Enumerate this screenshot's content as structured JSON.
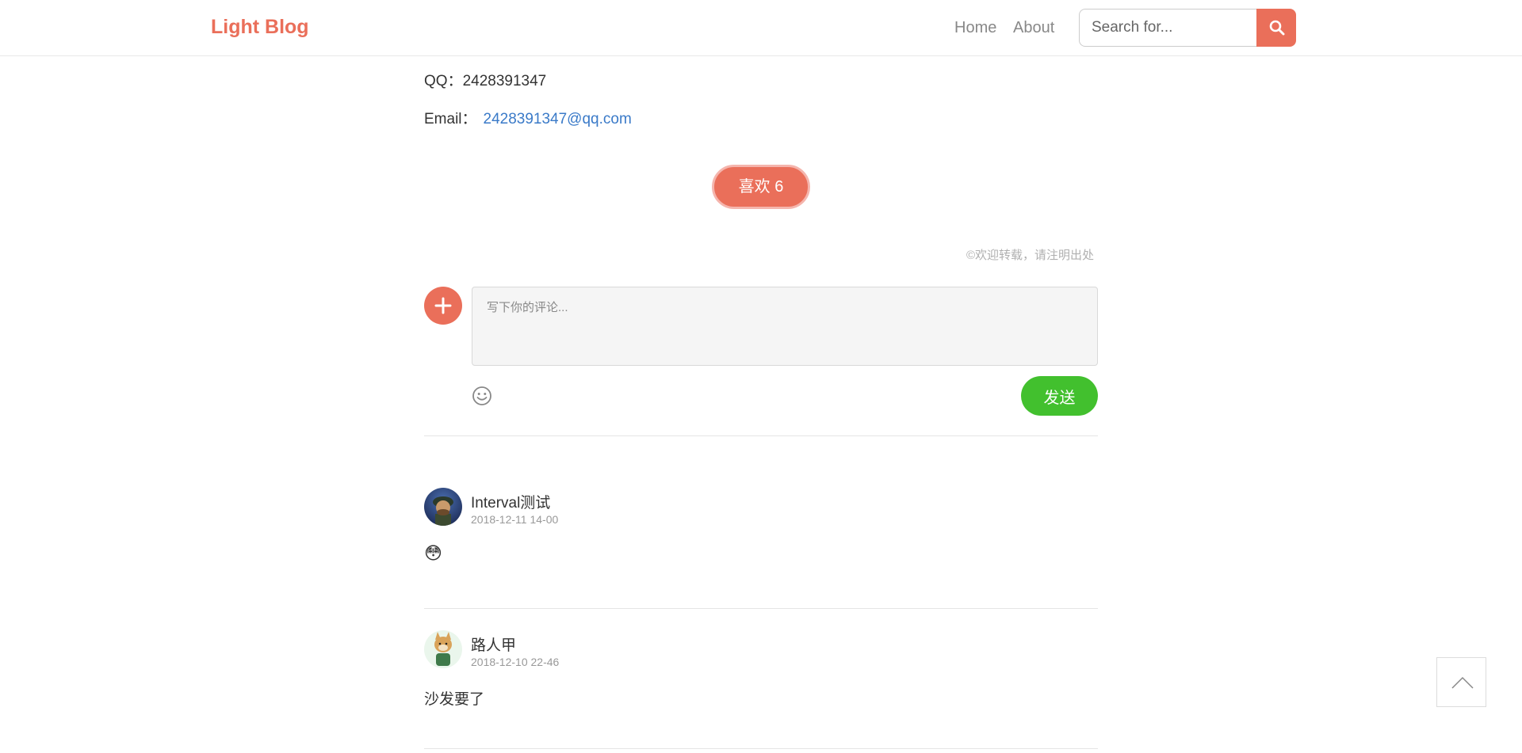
{
  "navbar": {
    "brand": "Light Blog",
    "links": [
      {
        "label": "Home"
      },
      {
        "label": "About"
      }
    ],
    "search": {
      "placeholder": "Search for...",
      "icon": "search-icon"
    }
  },
  "contact": {
    "qq_label": "QQ：",
    "qq_value": "2428391347",
    "email_label": "Email：",
    "email_value": "2428391347@qq.com"
  },
  "like": {
    "label": "喜欢",
    "count": "6"
  },
  "copyright": "©欢迎转载，请注明出处",
  "comment_form": {
    "placeholder": "写下你的评论...",
    "send_label": "发送",
    "avatar_icon": "plus-icon",
    "emoji_icon": "smiley-icon"
  },
  "comments": [
    {
      "name": "Interval测试",
      "time": "2018-12-11 14-00",
      "body": "😳"
    },
    {
      "name": "路人甲",
      "time": "2018-12-10 22-46",
      "body": "沙发要了"
    }
  ],
  "colors": {
    "brand": "#ea6f5a",
    "send": "#42c02e",
    "link": "#3a7ac8"
  },
  "back_to_top": {
    "icon": "chevron-up-icon"
  }
}
